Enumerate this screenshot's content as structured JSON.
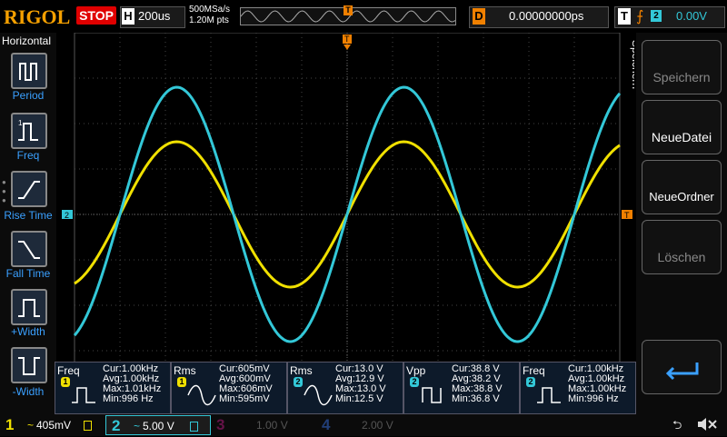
{
  "header": {
    "brand": "RIGOL",
    "run_state": "STOP",
    "horizontal_key": "H",
    "timebase": "200us",
    "sample_rate": "500MSa/s",
    "memory_depth": "1.20M pts",
    "trigger_position_marker": "T",
    "delay_key": "D",
    "delay_value": "0.00000000ps",
    "trigger_key": "T",
    "trigger_source": "2",
    "trigger_level": "0.00V"
  },
  "left_menu": {
    "title": "Horizontal",
    "items": [
      {
        "label": "Period",
        "icon": "period-icon"
      },
      {
        "label": "Freq",
        "icon": "freq-icon"
      },
      {
        "label": "Rise Time",
        "icon": "rise-time-icon"
      },
      {
        "label": "Fall Time",
        "icon": "fall-time-icon"
      },
      {
        "label": "+Width",
        "icon": "pos-width-icon"
      },
      {
        "label": "-Width",
        "icon": "neg-width-icon"
      }
    ]
  },
  "right_menu": {
    "title": "Speichern",
    "items": [
      {
        "label": "Speichern",
        "enabled": false
      },
      {
        "label": "NeueDatei",
        "enabled": true
      },
      {
        "label": "NeueOrdner",
        "enabled": true
      },
      {
        "label": "Löschen",
        "enabled": false
      },
      {
        "label": "",
        "enabled": true,
        "icon": "enter-arrow-icon"
      }
    ]
  },
  "markers": {
    "ch2_offset": "2",
    "trigger_level": "T",
    "trigger_time": "T"
  },
  "measurements": [
    {
      "name": "Freq",
      "channel": "1",
      "color": "#f0e000",
      "lines": [
        "Cur:1.00kHz",
        "Avg:1.00kHz",
        "Max:1.01kHz",
        "Min:996 Hz"
      ]
    },
    {
      "name": "Rms",
      "channel": "1",
      "color": "#f0e000",
      "lines": [
        "Cur:605mV",
        "Avg:600mV",
        "Max:606mV",
        "Min:595mV"
      ]
    },
    {
      "name": "Rms",
      "channel": "2",
      "color": "#33c8d8",
      "lines": [
        "Cur:13.0 V",
        "Avg:12.9 V",
        "Max:13.0 V",
        "Min:12.5 V"
      ]
    },
    {
      "name": "Vpp",
      "channel": "2",
      "color": "#33c8d8",
      "lines": [
        "Cur:38.8 V",
        "Avg:38.2 V",
        "Max:38.8 V",
        "Min:36.8 V"
      ]
    },
    {
      "name": "Freq",
      "channel": "2",
      "color": "#33c8d8",
      "lines": [
        "Cur:1.00kHz",
        "Avg:1.00kHz",
        "Max:1.00kHz",
        "Min:996 Hz"
      ]
    }
  ],
  "channels": [
    {
      "num": "1",
      "scale": "405mV",
      "color": "#f0e000",
      "active": true
    },
    {
      "num": "2",
      "scale": "5.00 V",
      "color": "#33c8d8",
      "active": true
    },
    {
      "num": "3",
      "scale": "1.00 V",
      "color": "#a01870",
      "active": false
    },
    {
      "num": "4",
      "scale": "2.00 V",
      "color": "#3060c0",
      "active": false
    }
  ],
  "colors": {
    "ch1": "#f0e000",
    "ch2": "#33c8d8",
    "trigger": "#f08000",
    "brand": "#f5a000"
  },
  "waveforms": {
    "period_divisions": 5,
    "ch1_amplitude_divisions": 1.6,
    "ch2_amplitude_divisions": 2.8
  }
}
